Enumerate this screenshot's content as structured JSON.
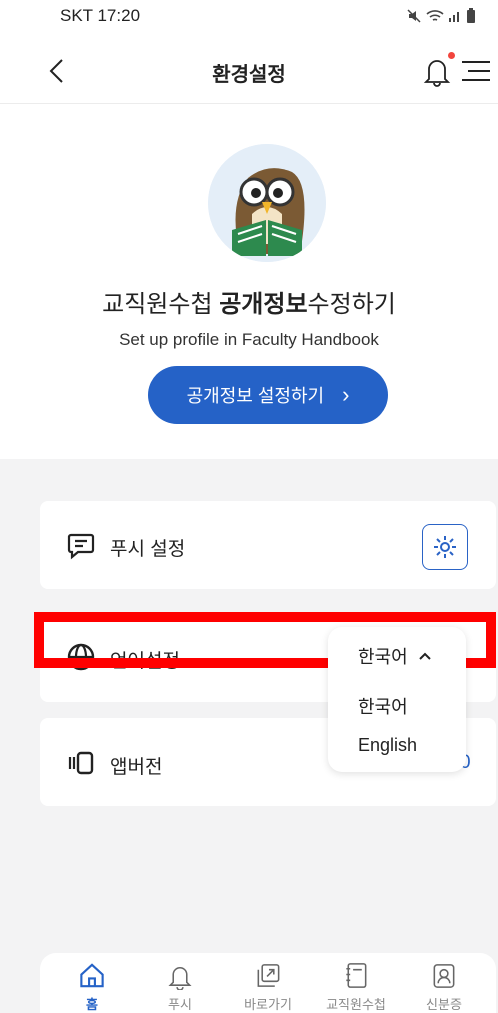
{
  "status_bar": {
    "carrier_time": "SKT 17:20"
  },
  "header": {
    "title": "환경설정"
  },
  "profile": {
    "headline_prefix": "교직원수첩 ",
    "headline_bold": "공개정보",
    "headline_suffix": "수정하기",
    "subtitle": "Set up profile in Faculty Handbook",
    "cta_label": "공개정보 설정하기",
    "cta_arrow": "›"
  },
  "settings": {
    "push": {
      "label": "푸시 설정"
    },
    "language": {
      "label": "언어설정",
      "selected": "한국어",
      "options": [
        "한국어",
        "English"
      ]
    },
    "version": {
      "label": "앱버전",
      "value": "0"
    }
  },
  "tabbar": {
    "items": [
      {
        "label": "홈",
        "icon": "home-icon",
        "active": true
      },
      {
        "label": "푸시",
        "icon": "bell-icon"
      },
      {
        "label": "바로가기",
        "icon": "shortcut-icon"
      },
      {
        "label": "교직원수첩",
        "icon": "notebook-icon"
      },
      {
        "label": "신분증",
        "icon": "id-card-icon"
      }
    ]
  },
  "colors": {
    "accent": "#2562c7",
    "highlight": "#ff0000",
    "notification_dot": "#f2453d"
  }
}
